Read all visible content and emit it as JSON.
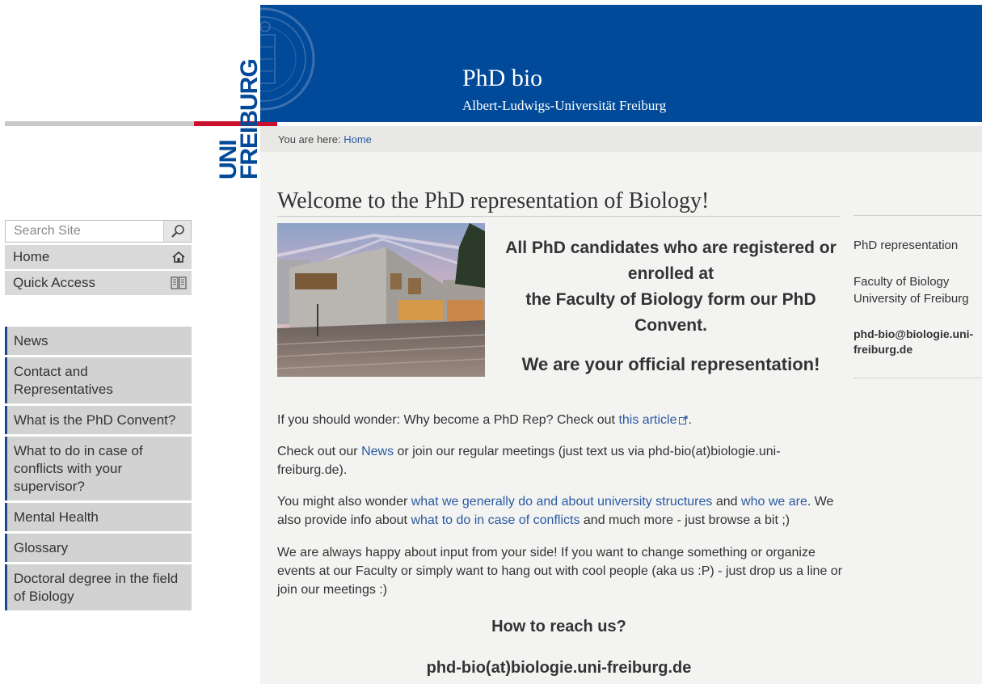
{
  "header": {
    "logo_text": "UNI FREIBURG",
    "site_title": "PhD bio",
    "site_subtitle": "Albert-Ludwigs-Universität Freiburg"
  },
  "breadcrumb": {
    "prefix": "You are here:",
    "link": "Home"
  },
  "search": {
    "placeholder": "Search Site"
  },
  "utility_nav": {
    "home": "Home",
    "quick_access": "Quick Access"
  },
  "nav": {
    "items": [
      "News",
      "Contact and Representatives",
      "What is the PhD Convent?",
      "What to do in case of conflicts with your supervisor?",
      "Mental Health",
      "Glossary",
      "Doctoral degree in the field of Biology"
    ]
  },
  "main": {
    "title": "Welcome to the PhD representation of Biology!",
    "intro_line1": "All PhD candidates who are registered or enrolled at",
    "intro_line2": "the Faculty of Biology form our PhD Convent.",
    "intro_line3": "We are your official representation!",
    "p1": {
      "text": "If you should wonder: Why become a PhD Rep? Check out",
      "link": "this article",
      "end": "."
    },
    "p2": {
      "a": "Check out our",
      "link": "News",
      "b": "or join our regular meetings (just text us via phd-bio(at)biologie.uni-freiburg.de)."
    },
    "p3": {
      "a": "You might also wonder",
      "link1": "what we generally do and about university structures",
      "b": "and",
      "link2": "who we are",
      "c": ". We also provide info about",
      "link3": "what to do in case of conflicts",
      "d": "and much more - just browse a bit ;)"
    },
    "p4": "We are always happy about input from your side! If you want to change something or organize events at our Faculty or simply want to hang out with cool people (aka us :P) - just drop us a line or join our meetings :)",
    "reach_title": "How to reach us?",
    "reach_email": "phd-bio(at)biologie.uni-freiburg.de"
  },
  "portlet": {
    "title": "PhD representation",
    "address": "Faculty of Biology University of Freiburg",
    "email": "phd-bio@biologie.uni-freiburg.de"
  },
  "colors": {
    "banner_blue": "#004a99",
    "uni_red": "#c8102e",
    "nav_accent": "#1a4b8c",
    "link": "#2a5aa0"
  }
}
